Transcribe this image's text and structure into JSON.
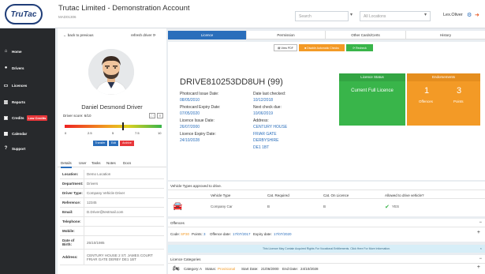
{
  "header": {
    "logo_text": "TruTac",
    "company": "Trutac Limited - Demonstration Account",
    "company_code": "MAD01306",
    "search_placeholder": "Search",
    "locations_placeholder": "All Locations",
    "user_name": "Lex.Oliver"
  },
  "sidebar": {
    "items": [
      {
        "label": "Home",
        "icon": "home-icon"
      },
      {
        "label": "Drivers",
        "icon": "user-icon"
      },
      {
        "label": "Licences",
        "icon": "id-card-icon"
      },
      {
        "label": "Reports",
        "icon": "chart-icon"
      },
      {
        "label": "Credits",
        "icon": "credits-icon",
        "badge": "Low Credits"
      },
      {
        "label": "Calendar",
        "icon": "calendar-icon"
      },
      {
        "label": "Support",
        "icon": "help-icon"
      }
    ]
  },
  "profile": {
    "back_label": "back to previous",
    "refresh_label": "refresh driver",
    "driver_name": "Daniel Desmond Driver",
    "score_label": "Driver score: 6/10",
    "score_value": 6,
    "score_max": 10,
    "score_ticks": [
      "0",
      "2.5",
      "5",
      "7.5",
      "10"
    ],
    "actions": [
      {
        "label": "Transfer",
        "color": "#2a6ebb"
      },
      {
        "label": "Edit",
        "color": "#2a6ebb"
      },
      {
        "label": "Archive",
        "color": "#e8363a"
      }
    ],
    "tabs": [
      "Details",
      "User",
      "Tasks",
      "Notes",
      "Docs"
    ],
    "details": [
      {
        "key": "Location:",
        "value": "Demo Location"
      },
      {
        "key": "Department:",
        "value": "Drivers"
      },
      {
        "key": "Driver Type:",
        "value": "Company Vehicle Driver"
      },
      {
        "key": "Reference:",
        "value": "12345"
      },
      {
        "key": "Email:",
        "value": "D.Driver@testmail.com"
      },
      {
        "key": "Telephone:",
        "value": ""
      },
      {
        "key": "Mobile:",
        "value": ""
      },
      {
        "key": "Date of Birth:",
        "value": "25/10/1985"
      },
      {
        "key": "Address:",
        "value": "CENTURY HOUSE 2 ST. JAMES COURT FRIAR GATE DERBY DE1 1BT"
      }
    ]
  },
  "main": {
    "tabs": [
      "Licence",
      "Permission",
      "Other Cards/Certs",
      "History"
    ],
    "buttons": [
      {
        "label": "View PDF"
      },
      {
        "label": "Disable Automatic Checks"
      },
      {
        "label": "Recheck"
      }
    ],
    "licence_number": "DRIVE810253DD8UH (99)",
    "fields": {
      "photocard_issue_label": "Photocard Issue Date:",
      "photocard_issue": "08/05/2010",
      "photocard_expiry_label": "Photocard Expiry Date:",
      "photocard_expiry": "07/05/2020",
      "licence_issue_label": "Licence Issue Date:",
      "licence_issue": "26/07/2000",
      "licence_expiry_label": "Licence Expiry Date:",
      "licence_expiry": "24/10/2028",
      "last_checked_label": "Date last checked:",
      "last_checked": "10/12/2018",
      "next_check_label": "Next check due:",
      "next_check": "10/06/2019",
      "address_label": "Address:",
      "address_lines": [
        "CENTURY HOUSE",
        "FRIAR GATE",
        "DERBYSHIRE",
        "DE1 1BT"
      ]
    },
    "licence_status": {
      "heading": "Licence Status",
      "value": "Current Full Licence"
    },
    "endorsements": {
      "heading": "Endorsements",
      "offences": "1",
      "offences_label": "Offences",
      "points": "3",
      "points_label": "Points"
    },
    "vehicle_types": {
      "heading": "Vehicle Types approved to drive.",
      "columns": [
        "Vehicle Type",
        "Cat. Required",
        "Cat. On Licence",
        "Allowed to drive vehicle?"
      ],
      "rows": [
        {
          "type": "Company Car",
          "required": "B",
          "on_licence": "B",
          "allowed": "YES"
        }
      ]
    },
    "offences": {
      "heading": "Offences",
      "code_label": "Code:",
      "code": "SP30",
      "points_label": "Points:",
      "points": "3",
      "offence_date_label": "Offence date:",
      "offence_date": "17/07/2017",
      "expiry_label": "Expiry date:",
      "expiry_date": "17/07/2020"
    },
    "alert": "This Licence May Contain Acquired Rights For Vocational Entitlements. Click Here For More Information.",
    "categories": {
      "heading": "Licence Categories",
      "category_label": "Category:",
      "category": "A",
      "status_label": "Status:",
      "status": "Provisional",
      "start_label": "Start Date:",
      "start": "21/06/2000",
      "end_label": "End Date:",
      "end": "24/10/2028"
    }
  }
}
